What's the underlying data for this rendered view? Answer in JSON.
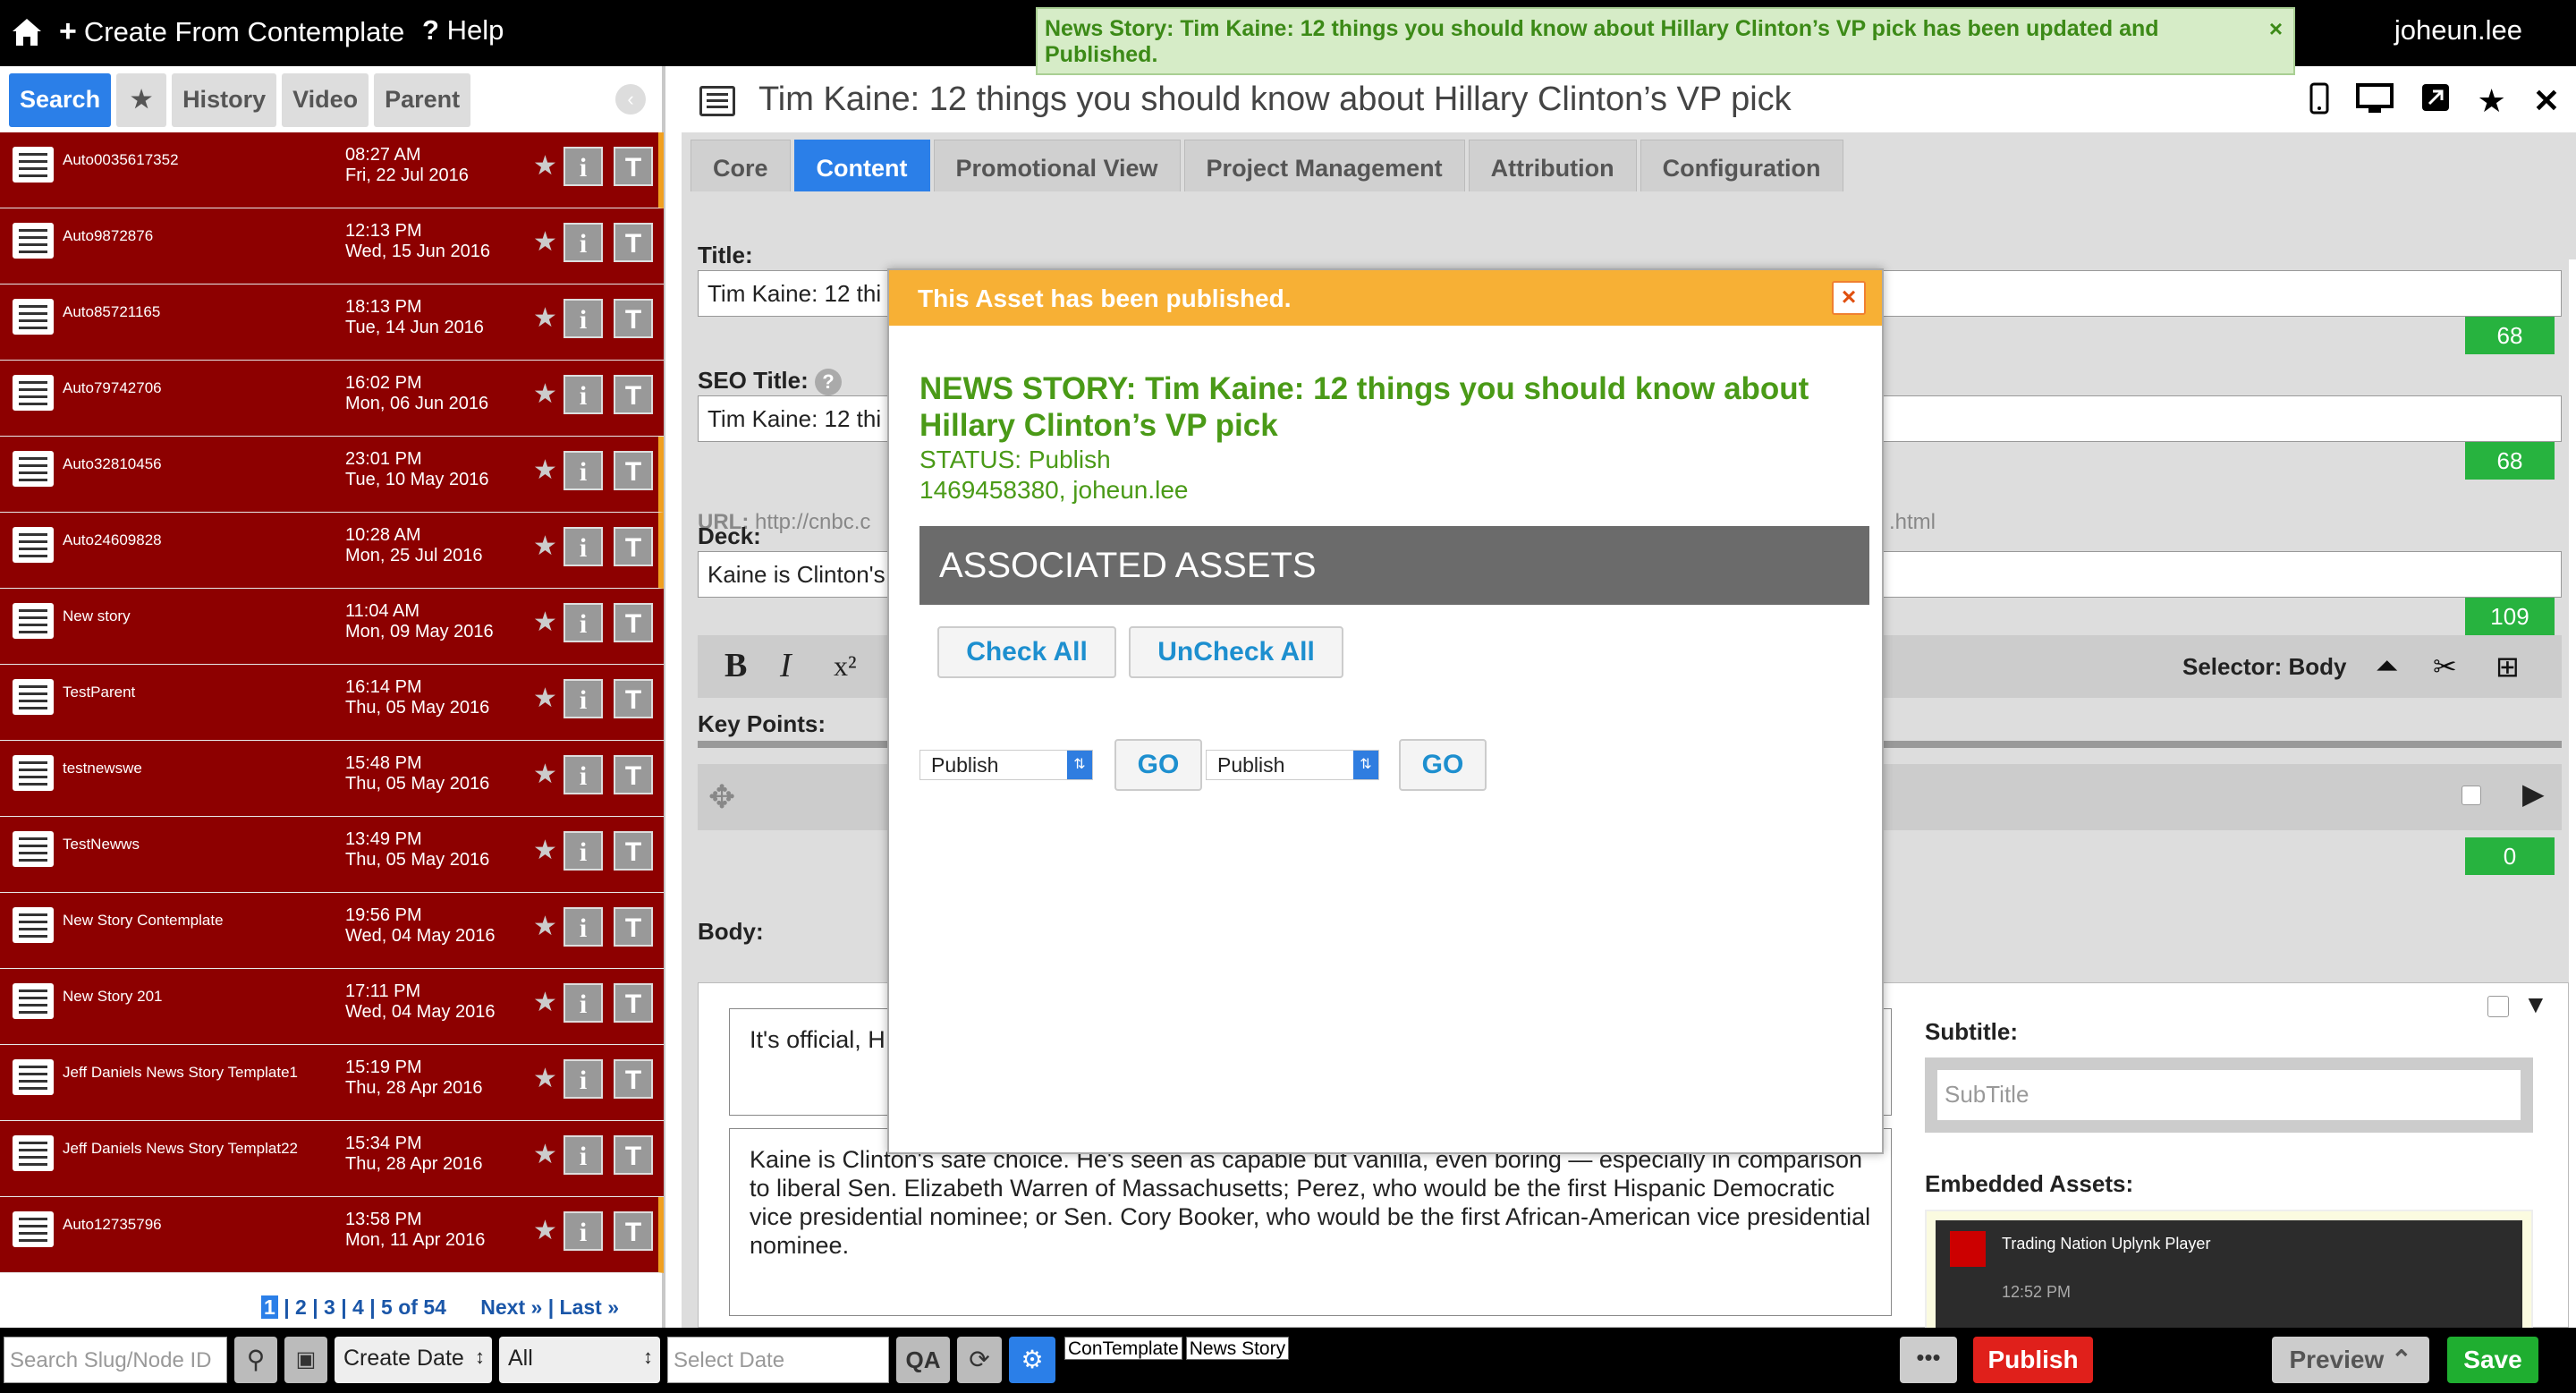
{
  "topbar": {
    "create_label": "Create From Contemplate",
    "help_label": "Help",
    "user": "joheun.lee"
  },
  "notification": {
    "text": "News Story: Tim Kaine: 12 things you should know about Hillary Clinton’s VP pick has been updated and Published.",
    "close": "×"
  },
  "sidebar": {
    "tabs": [
      "Search",
      "★",
      "History",
      "Video",
      "Parent"
    ],
    "rows": [
      {
        "slug": "Auto0035617352",
        "time": "08:27 AM",
        "date": "Fri, 22 Jul 2016",
        "flag": true
      },
      {
        "slug": "Auto9872876",
        "time": "12:13 PM",
        "date": "Wed, 15 Jun 2016",
        "flag": false
      },
      {
        "slug": "Auto85721165",
        "time": "18:13 PM",
        "date": "Tue, 14 Jun 2016",
        "flag": false
      },
      {
        "slug": "Auto79742706",
        "time": "16:02 PM",
        "date": "Mon, 06 Jun 2016",
        "flag": false
      },
      {
        "slug": "Auto32810456",
        "time": "23:01 PM",
        "date": "Tue, 10 May 2016",
        "flag": true
      },
      {
        "slug": "Auto24609828",
        "time": "10:28 AM",
        "date": "Mon, 25 Jul 2016",
        "flag": true
      },
      {
        "slug": "New story",
        "time": "11:04 AM",
        "date": "Mon, 09 May 2016",
        "flag": false
      },
      {
        "slug": "TestParent",
        "time": "16:14 PM",
        "date": "Thu, 05 May 2016",
        "flag": false
      },
      {
        "slug": "testnewswe",
        "time": "15:48 PM",
        "date": "Thu, 05 May 2016",
        "flag": false
      },
      {
        "slug": "TestNewws",
        "time": "13:49 PM",
        "date": "Thu, 05 May 2016",
        "flag": false
      },
      {
        "slug": "New Story Contemplate",
        "time": "19:56 PM",
        "date": "Wed, 04 May 2016",
        "flag": false
      },
      {
        "slug": "New Story 201",
        "time": "17:11 PM",
        "date": "Wed, 04 May 2016",
        "flag": false
      },
      {
        "slug": "Jeff Daniels News Story Template1",
        "time": "15:19 PM",
        "date": "Thu, 28 Apr 2016",
        "flag": false
      },
      {
        "slug": "Jeff Daniels News Story Templat22",
        "time": "15:34 PM",
        "date": "Thu, 28 Apr 2016",
        "flag": false
      },
      {
        "slug": "Auto12735796",
        "time": "13:58 PM",
        "date": "Mon, 11 Apr 2016",
        "flag": true
      }
    ],
    "pager": {
      "current": "1",
      "pages": "| 2 | 3 | 4 |",
      "total": "5 of 54",
      "next": "Next »",
      "last": "| Last »"
    }
  },
  "bottombar": {
    "search_placeholder": "Search Slug/Node ID",
    "sort_value": "Create Date",
    "filter_value": "All",
    "date_placeholder": "Select Date",
    "tags": [
      "ConTemplate",
      "News Story"
    ],
    "more": "•••",
    "publish": "Publish",
    "preview": "Preview",
    "save": "Save"
  },
  "editor": {
    "doc_title": "Tim Kaine: 12 things you should know about Hillary Clinton’s VP pick",
    "tabs": [
      "Core",
      "Content",
      "Promotional View",
      "Project Management",
      "Attribution",
      "Configuration"
    ],
    "title_label": "Title:",
    "title_value": "Tim Kaine: 12 thi",
    "title_count": "68",
    "seo_label": "SEO Title:",
    "seo_help": "?",
    "seo_value": "Tim Kaine: 12 thi",
    "seo_count": "68",
    "url_label": "URL:",
    "url_value": "http://cnbc.c",
    "url_end": ".html",
    "deck_label": "Deck:",
    "deck_value": "Kaine is Clinton's",
    "deck_count": "109",
    "selector_label": "Selector: Body",
    "key_points_label": "Key Points:",
    "key_points_count": "0",
    "body_label": "Body:",
    "para1": "It's official, H",
    "para2": "Kaine is Clinton's safe choice. He's seen as capable but vanilla, even boring — especially in comparison to liberal Sen. Elizabeth Warren of Massachusetts; Perez, who would be the first Hispanic Democratic vice presidential nominee; or Sen. Cory Booker, who would be the first African-American vice presidential nominee.",
    "subtitle_label": "Subtitle:",
    "subtitle_placeholder": "SubTitle",
    "embedded_label": "Embedded Assets:",
    "embedded_title": "Trading Nation Uplynk Player",
    "embedded_time": "12:52 PM"
  },
  "modal": {
    "header": "This Asset has been published.",
    "close": "×",
    "story": "NEWS STORY: Tim Kaine: 12 things you should know about Hillary Clinton’s VP pick",
    "status": "STATUS: Publish",
    "id_line": "1469458380, joheun.lee",
    "assoc_title": "ASSOCIATED ASSETS",
    "check_all": "Check All",
    "uncheck_all": "UnCheck All",
    "select1": "Publish",
    "go1": "GO",
    "select2": "Publish",
    "go2": "GO"
  }
}
